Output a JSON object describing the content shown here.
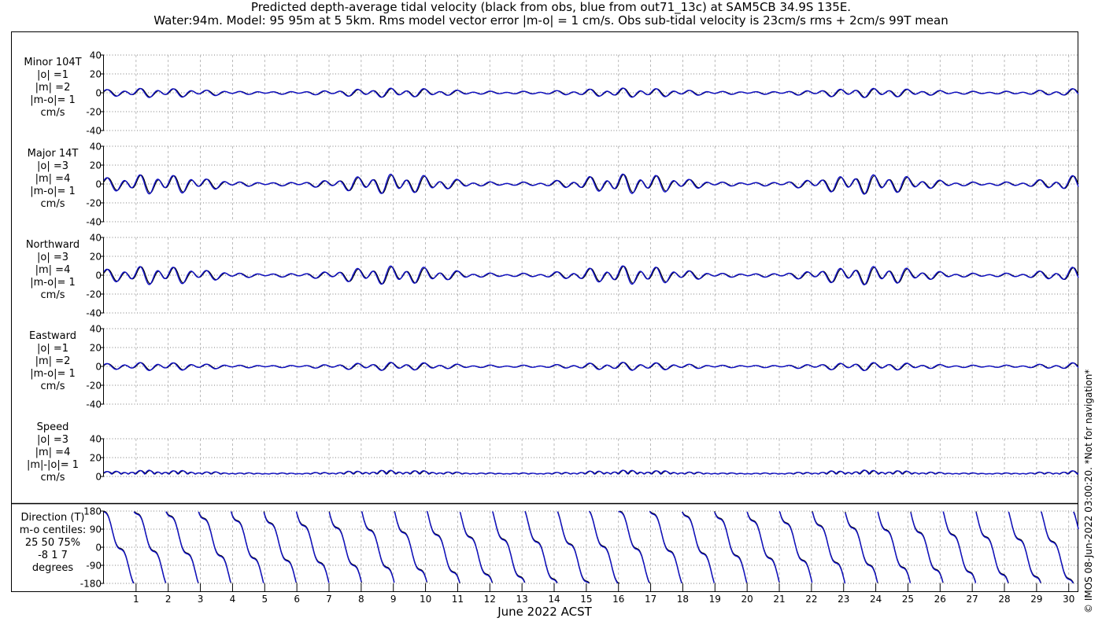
{
  "title_line1": "Predicted depth-average tidal velocity (black from obs, blue from out71_13c) at SAM5CB 34.9S 135E.",
  "title_line2": "Water:94m. Model: 95 95m at 5 5km. Rms model vector error |m-o| = 1 cm/s. Obs sub-tidal velocity is 23cm/s rms + 2cm/s 99T mean",
  "watermark": "© IMOS 08-Jun-2022 03:00:20. *Not for navigation*",
  "chart_data": {
    "type": "line",
    "xlabel": "June 2022 ACST",
    "xlim": [
      0,
      30.3
    ],
    "x_ticks": [
      1,
      2,
      3,
      4,
      5,
      6,
      7,
      8,
      9,
      10,
      11,
      12,
      13,
      14,
      15,
      16,
      17,
      18,
      19,
      20,
      21,
      22,
      23,
      24,
      25,
      26,
      27,
      28,
      29,
      30
    ],
    "colors": {
      "obs": "#000000",
      "model": "#1010c8"
    },
    "grid": true,
    "panels": [
      {
        "label_lines": [
          "Minor 104T",
          "|o| =1",
          "|m| =2",
          "|m-o|= 1",
          "cm/s"
        ],
        "ylim": [
          -40,
          40
        ],
        "yticks": [
          "40",
          "20",
          "0",
          "-20",
          "-40"
        ],
        "yvals": [
          40,
          20,
          0,
          -20,
          -40
        ],
        "amp_neap": 1.2,
        "amp_spring": 4.0,
        "offset": 0,
        "kind": "signed"
      },
      {
        "label_lines": [
          "Major 14T",
          "|o| =3",
          "|m| =4",
          "|m-o|= 1",
          "cm/s"
        ],
        "ylim": [
          -40,
          40
        ],
        "yticks": [
          "40",
          "20",
          "0",
          "-20",
          "-40"
        ],
        "yvals": [
          40,
          20,
          0,
          -20,
          -40
        ],
        "amp_neap": 1.5,
        "amp_spring": 8.5,
        "offset": 0,
        "kind": "signed"
      },
      {
        "label_lines": [
          "Northward",
          "|o| =3",
          "|m| =4",
          "|m-o|= 1",
          "cm/s"
        ],
        "ylim": [
          -40,
          40
        ],
        "yticks": [
          "40",
          "20",
          "0",
          "-20",
          "-40"
        ],
        "yvals": [
          40,
          20,
          0,
          -20,
          -40
        ],
        "amp_neap": 1.5,
        "amp_spring": 8.0,
        "offset": 0,
        "kind": "signed"
      },
      {
        "label_lines": [
          "Eastward",
          "|o| =1",
          "|m| =2",
          "|m-o|= 1",
          "cm/s"
        ],
        "ylim": [
          -40,
          40
        ],
        "yticks": [
          "40",
          "20",
          "0",
          "-20",
          "-40"
        ],
        "yvals": [
          40,
          20,
          0,
          -20,
          -40
        ],
        "amp_neap": 1.0,
        "amp_spring": 3.5,
        "offset": 0,
        "kind": "signed"
      },
      {
        "label_lines": [
          "Speed",
          "|o| =3",
          "|m| =4",
          "|m|-|o|= 1",
          "cm/s"
        ],
        "ylim": [
          0,
          40
        ],
        "yticks": [
          "40",
          "20",
          "0"
        ],
        "yvals": [
          40,
          20,
          0
        ],
        "amp_neap": 1.0,
        "amp_spring": 3.5,
        "offset": 2.5,
        "kind": "speed"
      },
      {
        "label_lines": [
          "Direction (T)",
          "m-o centiles:",
          "25  50  75%",
          "-8  1  7",
          "degrees"
        ],
        "ylim": [
          -180,
          180
        ],
        "yticks": [
          "180",
          "90",
          "0",
          "-90",
          "-180"
        ],
        "yvals": [
          180,
          90,
          0,
          -90,
          -180
        ],
        "kind": "direction"
      }
    ]
  }
}
